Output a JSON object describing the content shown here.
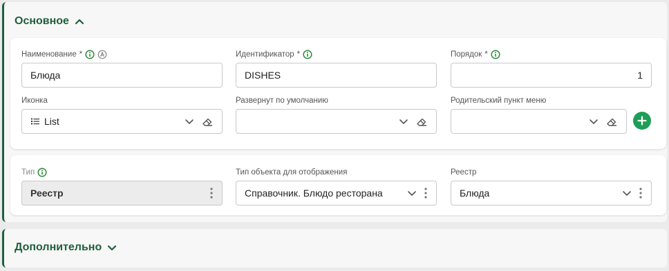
{
  "sections": {
    "main": {
      "title": "Основное"
    },
    "extra": {
      "title": "Дополнительно"
    }
  },
  "card1": {
    "name": {
      "label": "Наименование",
      "required": "*",
      "value": "Блюда"
    },
    "identifier": {
      "label": "Идентификатор",
      "required": "*",
      "value": "DISHES"
    },
    "order": {
      "label": "Порядок",
      "required": "*",
      "value": "1"
    },
    "icon": {
      "label": "Иконка",
      "value": "List",
      "icon": "list-icon"
    },
    "expanded": {
      "label": "Развернут по умолчанию",
      "value": ""
    },
    "parent": {
      "label": "Родительский пункт меню",
      "value": ""
    }
  },
  "card2": {
    "type": {
      "label": "Тип",
      "value": "Реестр"
    },
    "display_type": {
      "label": "Тип объекта для отображения",
      "value": "Справочник. Блюдо ресторана"
    },
    "registry": {
      "label": "Реестр",
      "value": "Блюда"
    }
  },
  "colors": {
    "accent": "#1f5f3c",
    "add_button": "#1e9e57",
    "info": "#2e8b3a"
  }
}
